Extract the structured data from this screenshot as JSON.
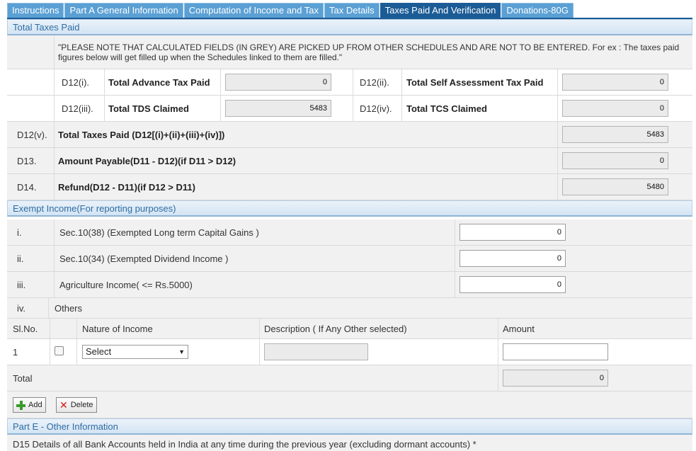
{
  "tabs": [
    {
      "label": "Instructions"
    },
    {
      "label": "Part A General Information"
    },
    {
      "label": "Computation of Income and Tax"
    },
    {
      "label": "Tax Details"
    },
    {
      "label": "Taxes Paid And Verification"
    },
    {
      "label": "Donations-80G"
    }
  ],
  "active_tab": "Taxes Paid And Verification",
  "total_taxes": {
    "heading": "Total Taxes Paid",
    "note": "\"PLEASE NOTE THAT CALCULATED FIELDS (IN GREY) ARE PICKED UP FROM OTHER SCHEDULES AND ARE NOT TO BE ENTERED. For ex : The taxes paid figures below will get filled up when the Schedules linked to them are filled.\"",
    "d12i": {
      "code": "D12(i).",
      "label": "Total Advance Tax Paid",
      "value": "0"
    },
    "d12ii": {
      "code": "D12(ii).",
      "label": "Total Self Assessment Tax Paid",
      "value": "0"
    },
    "d12iii": {
      "code": "D12(iii).",
      "label": "Total TDS Claimed",
      "value": "5483"
    },
    "d12iv": {
      "code": "D12(iv).",
      "label": "Total TCS Claimed",
      "value": "0"
    },
    "d12v": {
      "code": "D12(v).",
      "label": "Total Taxes Paid (D12[(i)+(ii)+(iii)+(iv)])",
      "value": "5483"
    },
    "d13": {
      "code": "D13.",
      "label": "Amount Payable(D11 - D12)(if D11 > D12)",
      "value": "0"
    },
    "d14": {
      "code": "D14.",
      "label": "Refund(D12 - D11)(if D12 > D11)",
      "value": "5480"
    }
  },
  "exempt": {
    "heading": "Exempt Income(For reporting purposes)",
    "rows": [
      {
        "code": "i.",
        "label": "Sec.10(38) (Exempted Long term Capital Gains )",
        "value": "0"
      },
      {
        "code": "ii.",
        "label": "Sec.10(34) (Exempted Dividend Income )",
        "value": "0"
      },
      {
        "code": "iii.",
        "label": "Agriculture Income( <= Rs.5000)",
        "value": "0"
      }
    ],
    "others_code": "iv.",
    "others_label": "Others",
    "columns": {
      "slno": "Sl.No.",
      "nature": "Nature of Income",
      "description": "Description ( If Any Other selected)",
      "amount": "Amount"
    },
    "row1": {
      "slno": "1",
      "nature_selected": "Select",
      "description": "",
      "amount": ""
    },
    "total_label": "Total",
    "total_value": "0",
    "add_label": "Add",
    "delete_label": "Delete"
  },
  "part_e": {
    "heading": "Part E - Other Information",
    "d15": "D15 Details of all Bank Accounts held in India at any time during the previous year (excluding dormant accounts) *"
  }
}
